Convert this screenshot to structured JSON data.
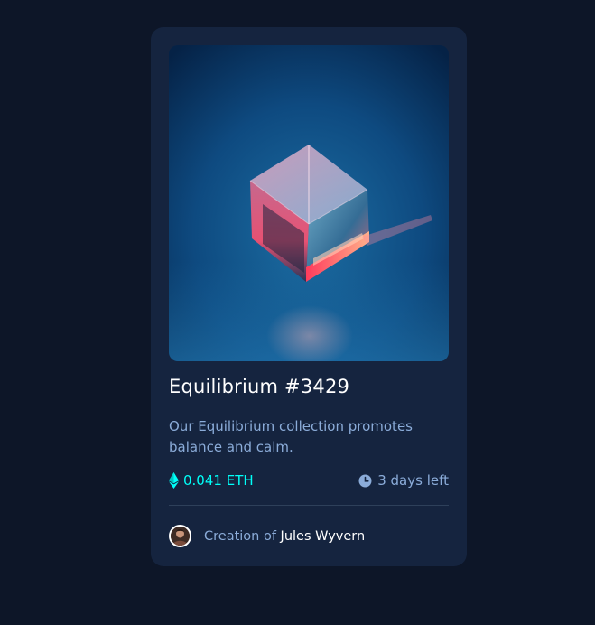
{
  "colors": {
    "page_background": "#0d1628",
    "card_background": "#15243f",
    "accent_cyan": "#00fff8",
    "soft_blue": "#8bacd9",
    "divider": "#2e405a"
  },
  "card": {
    "image_alt": "equilibrium-cube-image",
    "title": "Equilibrium #3429",
    "description": "Our Equilibrium collection promotes balance and calm.",
    "price": {
      "icon": "ethereum-icon",
      "value": "0.041 ETH"
    },
    "time_left": {
      "icon": "clock-icon",
      "value": "3 days left"
    },
    "creator": {
      "avatar_icon": "avatar",
      "prefix": "Creation of",
      "name": "Jules Wyvern"
    }
  }
}
